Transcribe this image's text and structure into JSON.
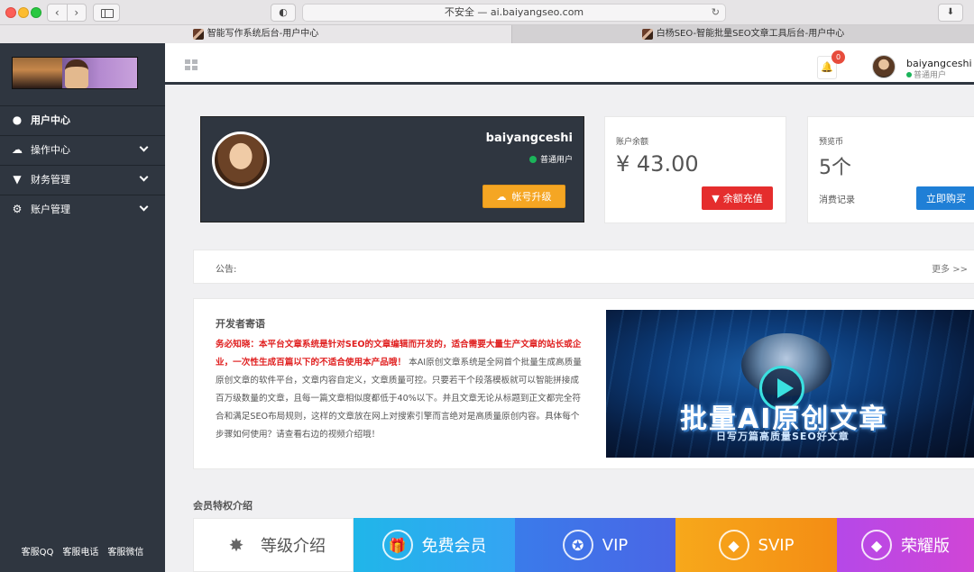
{
  "browser": {
    "address": "不安全 — ai.baiyangseo.com",
    "tabs": [
      {
        "label": "智能写作系统后台-用户中心"
      },
      {
        "label": "白杨SEO-智能批量SEO文章工具后台-用户中心"
      }
    ]
  },
  "sidebar": {
    "items": [
      {
        "label": "用户中心",
        "icon": "user-icon"
      },
      {
        "label": "操作中心",
        "icon": "cloud-icon"
      },
      {
        "label": "财务管理",
        "icon": "cart-icon"
      },
      {
        "label": "账户管理",
        "icon": "gears-icon"
      }
    ],
    "footer": [
      "客服QQ",
      "客服电话",
      "客服微信"
    ]
  },
  "header": {
    "notification_count": "0",
    "username": "baiyangceshi",
    "role": "普通用户"
  },
  "profile": {
    "username": "baiyangceshi",
    "role": "普通用户",
    "upgrade_label": "帐号升级"
  },
  "balance": {
    "label": "账户余额",
    "value": "¥ 43.00",
    "recharge_label": "余额充值"
  },
  "coins": {
    "label": "预览币",
    "value": "5个",
    "records_label": "消费记录",
    "buy_label": "立即购买"
  },
  "notice": {
    "label": "公告:",
    "more": "更多 >>"
  },
  "developer": {
    "title": "开发者寄语",
    "highlight": "务必知晓：本平台文章系统是针对SEO的文章编辑而开发的，适合需要大量生产文章的站长或企业，一次性生成百篇以下的不适合使用本产品哦！",
    "body": " 本AI原创文章系统是全网首个批量生成高质量原创文章的软件平台，文章内容自定义，文章质量可控。只要若干个段落模板就可以智能拼接成百万级数量的文章，且每一篇文章相似度都低于40%以下。并且文章无论从标题到正文都完全符合和满足SEO布局规则，这样的文章放在网上对搜索引擎而言绝对是高质量原创内容。具体每个步骤如何使用？请查看右边的视频介绍哦！",
    "video_title": "批量AI原创文章",
    "video_subtitle": "日写万篇高质量SEO好文章"
  },
  "membership": {
    "title": "会员特权介绍",
    "tiers": [
      {
        "label": "等级介绍",
        "icon": "star-icon"
      },
      {
        "label": "免费会员",
        "icon": "gift-icon"
      },
      {
        "label": "VIP",
        "icon": "medal-icon"
      },
      {
        "label": "SVIP",
        "icon": "diamond-icon"
      },
      {
        "label": "荣耀版",
        "icon": "diamond-icon"
      }
    ]
  }
}
